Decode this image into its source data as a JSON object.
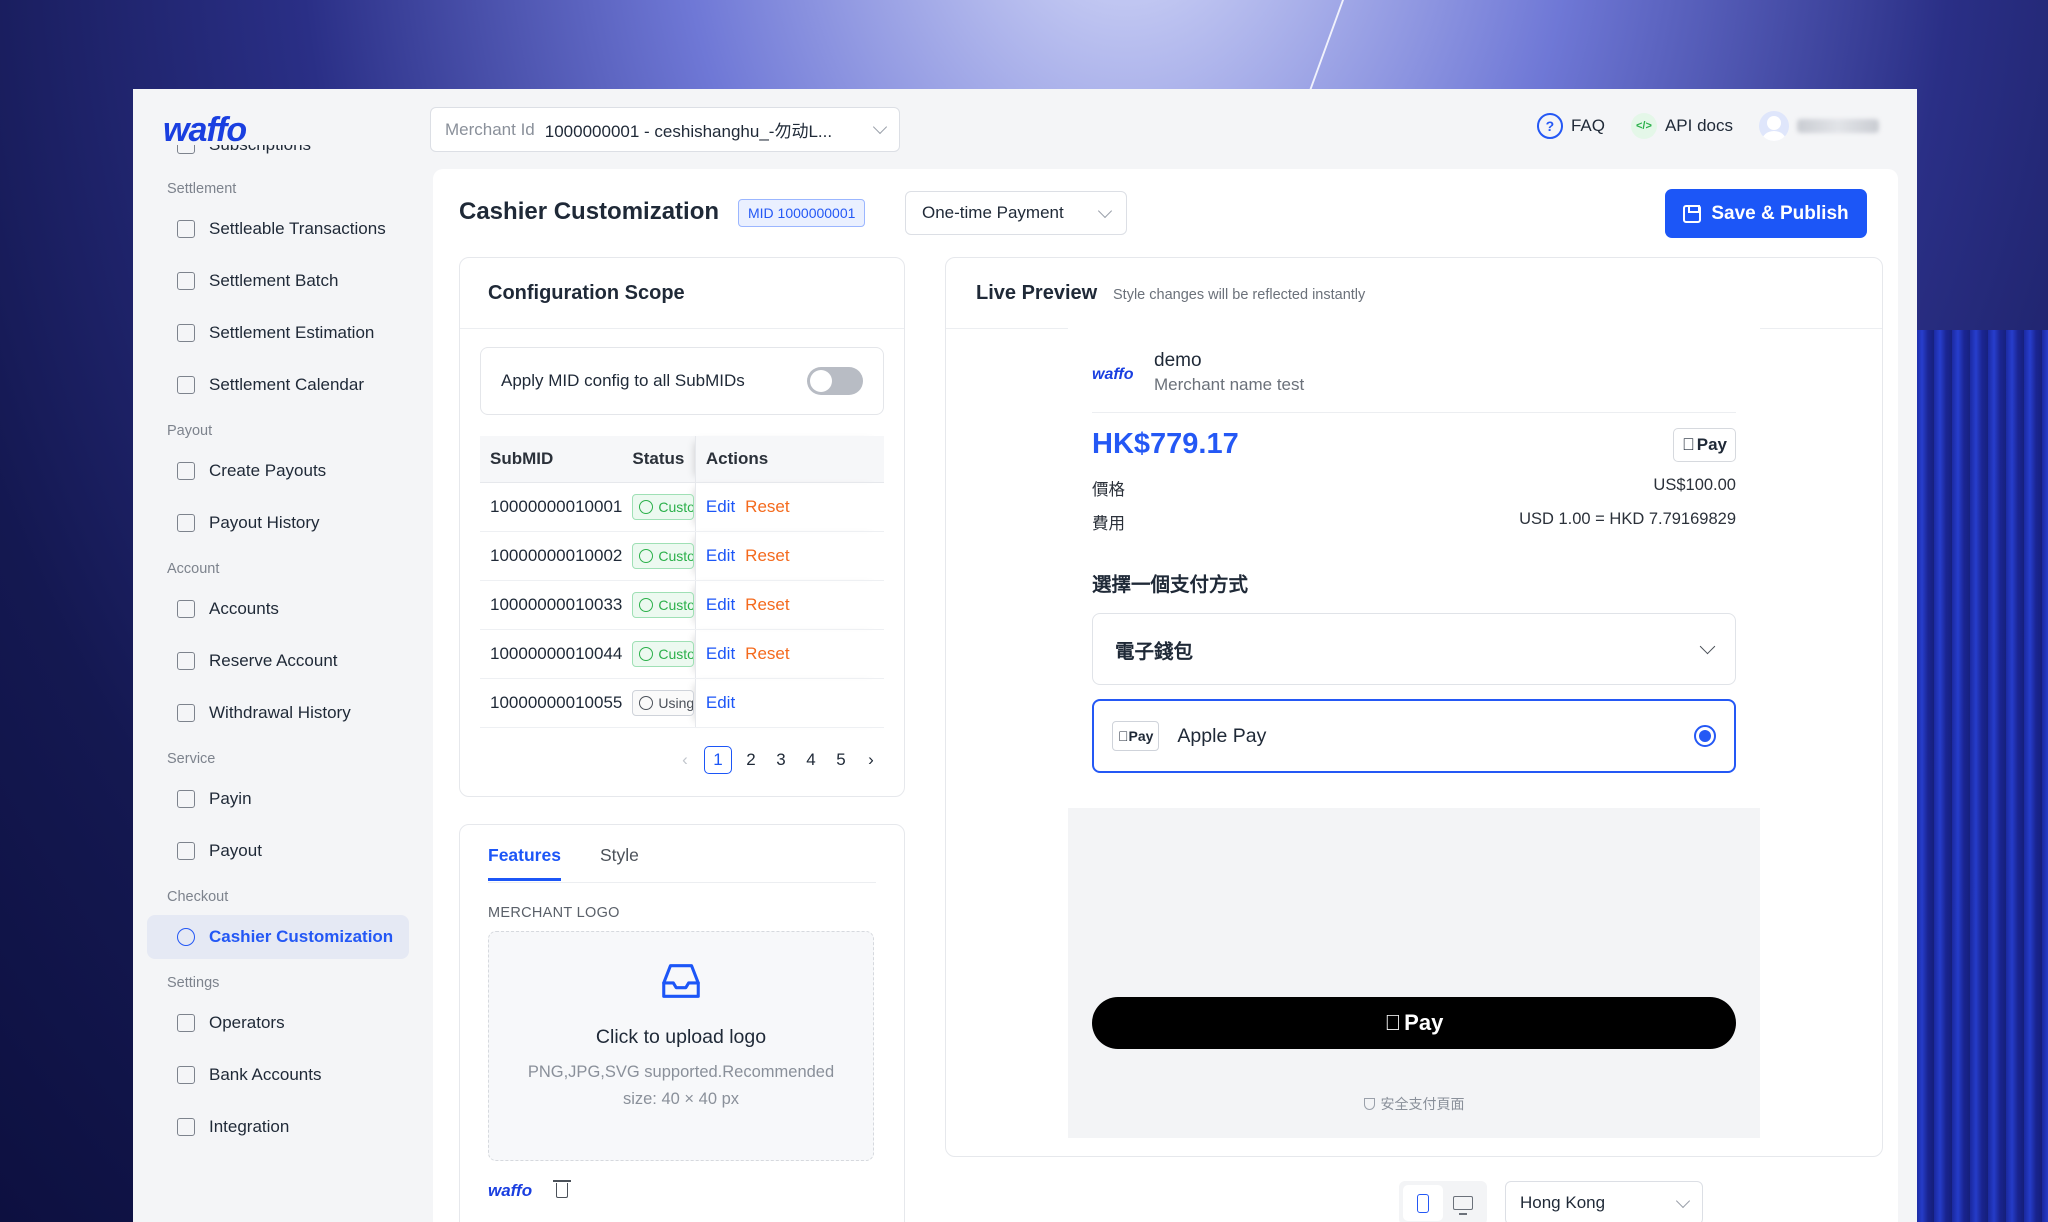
{
  "brand": {
    "logo": "waffo"
  },
  "header": {
    "merchant_label": "Merchant Id",
    "merchant_value": "1000000001 - ceshishanghu_-勿动L...",
    "faq": "FAQ",
    "api_docs": "API docs"
  },
  "sidebar": {
    "partial_item": "Subscriptions",
    "sections": [
      {
        "title": "Settlement",
        "items": [
          "Settleable Transactions",
          "Settlement Batch",
          "Settlement Estimation",
          "Settlement Calendar"
        ]
      },
      {
        "title": "Payout",
        "items": [
          "Create Payouts",
          "Payout History"
        ]
      },
      {
        "title": "Account",
        "items": [
          "Accounts",
          "Reserve Account",
          "Withdrawal History"
        ]
      },
      {
        "title": "Service",
        "items": [
          "Payin",
          "Payout"
        ]
      },
      {
        "title": "Checkout",
        "items": [
          "Cashier Customization"
        ]
      },
      {
        "title": "Settings",
        "items": [
          "Operators",
          "Bank Accounts",
          "Integration"
        ]
      }
    ],
    "active_item": "Cashier Customization"
  },
  "page": {
    "title": "Cashier Customization",
    "mid_badge": "MID 1000000001",
    "payment_type": "One-time Payment",
    "publish_label": "Save & Publish"
  },
  "config": {
    "title": "Configuration Scope",
    "apply_all_label": "Apply MID config to all SubMIDs",
    "apply_all_on": false,
    "columns": [
      "SubMID",
      "Status",
      "Actions"
    ],
    "rows": [
      {
        "submid": "10000000010001",
        "status": "Customized",
        "edit": "Edit",
        "reset": "Reset"
      },
      {
        "submid": "10000000010002",
        "status": "Customized",
        "edit": "Edit",
        "reset": "Reset"
      },
      {
        "submid": "10000000010033",
        "status": "Customized",
        "edit": "Edit",
        "reset": "Reset"
      },
      {
        "submid": "10000000010044",
        "status": "Customized",
        "edit": "Edit",
        "reset": "Reset"
      },
      {
        "submid": "10000000010055",
        "status": "Using MID",
        "edit": "Edit",
        "reset": ""
      }
    ],
    "pages": [
      "1",
      "2",
      "3",
      "4",
      "5"
    ],
    "current_page": "1"
  },
  "features": {
    "tabs": [
      "Features",
      "Style"
    ],
    "active_tab": "Features",
    "logo_section": "MERCHANT LOGO",
    "upload_title": "Click to upload logo",
    "upload_hint": "PNG,JPG,SVG supported.Recommended size: 40 × 40 px",
    "current_logo": "waffo"
  },
  "preview": {
    "title": "Live Preview",
    "subtitle": "Style changes will be reflected instantly",
    "logo": "waffo",
    "merchant": "demo",
    "merchant_name": "Merchant name test",
    "amount": "HK$779.17",
    "apple_pay_badge": "Pay",
    "price_label": "價格",
    "price_value": "US$100.00",
    "fee_label": "費用",
    "fee_value": "USD 1.00 = HKD 7.79169829",
    "choose_label": "選擇一個支付方式",
    "wallet_label": "電子錢包",
    "apple_pay_label": "Apple Pay",
    "pay_button": "Pay",
    "secure_label": "安全支付頁面"
  },
  "footer": {
    "region": "Hong Kong"
  },
  "colors": {
    "primary": "#1c56f7",
    "success": "#2bb04a",
    "reset": "#f46a1d",
    "amount": "#2458f5"
  }
}
